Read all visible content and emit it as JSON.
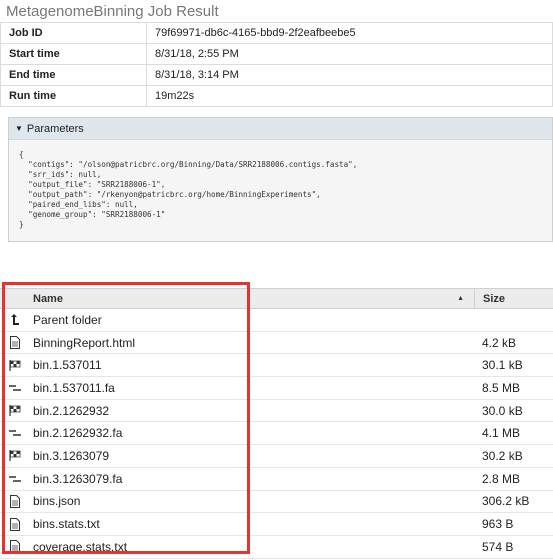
{
  "page": {
    "title": "MetagenomeBinning Job Result"
  },
  "job_info": [
    {
      "label": "Job ID",
      "value": "79f69971-db6c-4165-bbd9-2f2eafbeebe5"
    },
    {
      "label": "Start time",
      "value": "8/31/18, 2:55 PM"
    },
    {
      "label": "End time",
      "value": "8/31/18, 3:14 PM"
    },
    {
      "label": "Run time",
      "value": "19m22s"
    }
  ],
  "parameters": {
    "header": "Parameters",
    "body": "{\n  \"contigs\": \"/olson@patricbrc.org/Binning/Data/SRR2188006.contigs.fasta\",\n  \"srr_ids\": null,\n  \"output_file\": \"SRR2188006-1\",\n  \"output_path\": \"/rkenyon@patricbrc.org/home/BinningExperiments\",\n  \"paired_end_libs\": null,\n  \"genome_group\": \"SRR2188006-1\"\n}"
  },
  "file_table": {
    "columns": {
      "name": "Name",
      "size": "Size"
    },
    "rows": [
      {
        "icon": "parent-folder-icon",
        "name": "Parent folder",
        "size": ""
      },
      {
        "icon": "document-icon",
        "name": "BinningReport.html",
        "size": "4.2 kB"
      },
      {
        "icon": "genome-flag-icon",
        "name": "bin.1.537011",
        "size": "30.1 kB"
      },
      {
        "icon": "contigs-icon",
        "name": "bin.1.537011.fa",
        "size": "8.5 MB"
      },
      {
        "icon": "genome-flag-icon",
        "name": "bin.2.1262932",
        "size": "30.0 kB"
      },
      {
        "icon": "contigs-icon",
        "name": "bin.2.1262932.fa",
        "size": "4.1 MB"
      },
      {
        "icon": "genome-flag-icon",
        "name": "bin.3.1263079",
        "size": "30.2 kB"
      },
      {
        "icon": "contigs-icon",
        "name": "bin.3.1263079.fa",
        "size": "2.8 MB"
      },
      {
        "icon": "document-icon",
        "name": "bins.json",
        "size": "306.2 kB"
      },
      {
        "icon": "document-icon",
        "name": "bins.stats.txt",
        "size": "963 B"
      },
      {
        "icon": "document-icon",
        "name": "coverage.stats.txt",
        "size": "574 B"
      }
    ]
  },
  "colors": {
    "highlight": "#e8322e",
    "panel_header": "#dfe6ec"
  }
}
